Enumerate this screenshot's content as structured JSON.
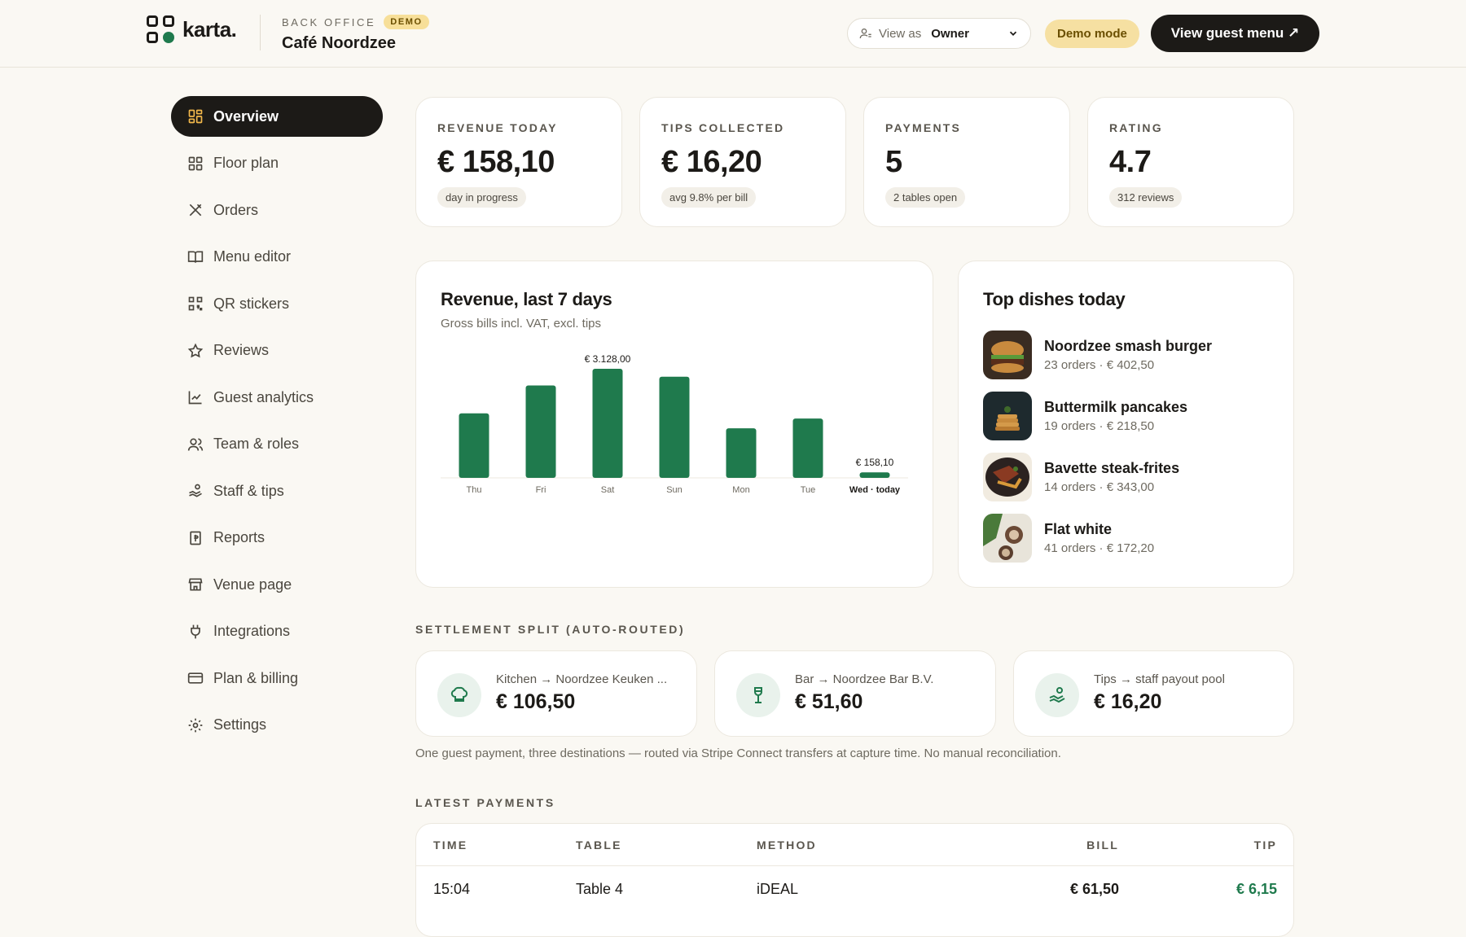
{
  "header": {
    "brand": "karta.",
    "section": "BACK OFFICE",
    "demo_badge": "DEMO",
    "venue": "Café Noordzee",
    "view_as_label": "View as",
    "view_as_value": "Owner",
    "demo_mode": "Demo mode",
    "guest_menu_button": "View guest menu ↗"
  },
  "sidebar": {
    "items": [
      {
        "label": "Overview",
        "icon": "grid-icon"
      },
      {
        "label": "Floor plan",
        "icon": "layout-icon"
      },
      {
        "label": "Orders",
        "icon": "utensils-icon"
      },
      {
        "label": "Menu editor",
        "icon": "book-icon"
      },
      {
        "label": "QR stickers",
        "icon": "qr-icon"
      },
      {
        "label": "Reviews",
        "icon": "star-icon"
      },
      {
        "label": "Guest analytics",
        "icon": "line-chart-icon"
      },
      {
        "label": "Team & roles",
        "icon": "users-icon"
      },
      {
        "label": "Staff & tips",
        "icon": "hand-coins-icon"
      },
      {
        "label": "Reports",
        "icon": "receipt-icon"
      },
      {
        "label": "Venue page",
        "icon": "store-icon"
      },
      {
        "label": "Integrations",
        "icon": "plug-icon"
      },
      {
        "label": "Plan & billing",
        "icon": "card-icon"
      },
      {
        "label": "Settings",
        "icon": "gear-icon"
      }
    ]
  },
  "stats": [
    {
      "label": "REVENUE TODAY",
      "value": "€ 158,10",
      "chip": "day in progress"
    },
    {
      "label": "TIPS COLLECTED",
      "value": "€ 16,20",
      "chip": "avg 9.8% per bill"
    },
    {
      "label": "PAYMENTS",
      "value": "5",
      "chip": "2 tables open"
    },
    {
      "label": "RATING",
      "value": "4.7",
      "chip": "312 reviews"
    }
  ],
  "revenue_chart": {
    "title": "Revenue, last 7 days",
    "subtitle": "Gross bills incl. VAT, excl. tips"
  },
  "chart_data": {
    "type": "bar",
    "title": "Revenue, last 7 days",
    "subtitle": "Gross bills incl. VAT, excl. tips",
    "categories": [
      "Thu",
      "Fri",
      "Sat",
      "Sun",
      "Mon",
      "Tue",
      "Wed · today"
    ],
    "values": [
      1850,
      2650,
      3128,
      2900,
      1420,
      1700,
      158.1
    ],
    "data_labels": {
      "2": "€ 3.128,00",
      "6": "€ 158,10"
    },
    "highlight_index": 6,
    "ylim": [
      0,
      3128
    ],
    "color": "#1f7a4d",
    "grid": false
  },
  "top_dishes": {
    "title": "Top dishes today",
    "items": [
      {
        "name": "Noordzee smash burger",
        "meta": "23 orders · € 402,50"
      },
      {
        "name": "Buttermilk pancakes",
        "meta": "19 orders · € 218,50"
      },
      {
        "name": "Bavette steak-frites",
        "meta": "14 orders · € 343,00"
      },
      {
        "name": "Flat white",
        "meta": "41 orders · € 172,20"
      }
    ]
  },
  "settlement": {
    "title": "SETTLEMENT SPLIT (AUTO-ROUTED)",
    "items": [
      {
        "dest": "Kitchen → Noordzee Keuken ...",
        "amount": "€ 106,50",
        "icon": "chef-hat-icon"
      },
      {
        "dest": "Bar → Noordzee Bar B.V.",
        "amount": "€ 51,60",
        "icon": "wine-glass-icon"
      },
      {
        "dest": "Tips → staff payout pool",
        "amount": "€ 16,20",
        "icon": "hand-coins-icon"
      }
    ],
    "note": "One guest payment, three destinations — routed via Stripe Connect transfers at capture time. No manual reconciliation."
  },
  "payments": {
    "title": "LATEST PAYMENTS",
    "columns": {
      "time": "TIME",
      "table": "TABLE",
      "method": "METHOD",
      "bill": "BILL",
      "tip": "TIP"
    },
    "rows": [
      {
        "time": "15:04",
        "table": "Table 4",
        "method": "iDEAL",
        "bill": "€ 61,50",
        "tip": "€ 6,15"
      }
    ]
  },
  "colors": {
    "accent": "#1f7a4d",
    "dark": "#1c1a17",
    "demo": "#f6e0a2",
    "active_icon": "#f2b84b"
  }
}
